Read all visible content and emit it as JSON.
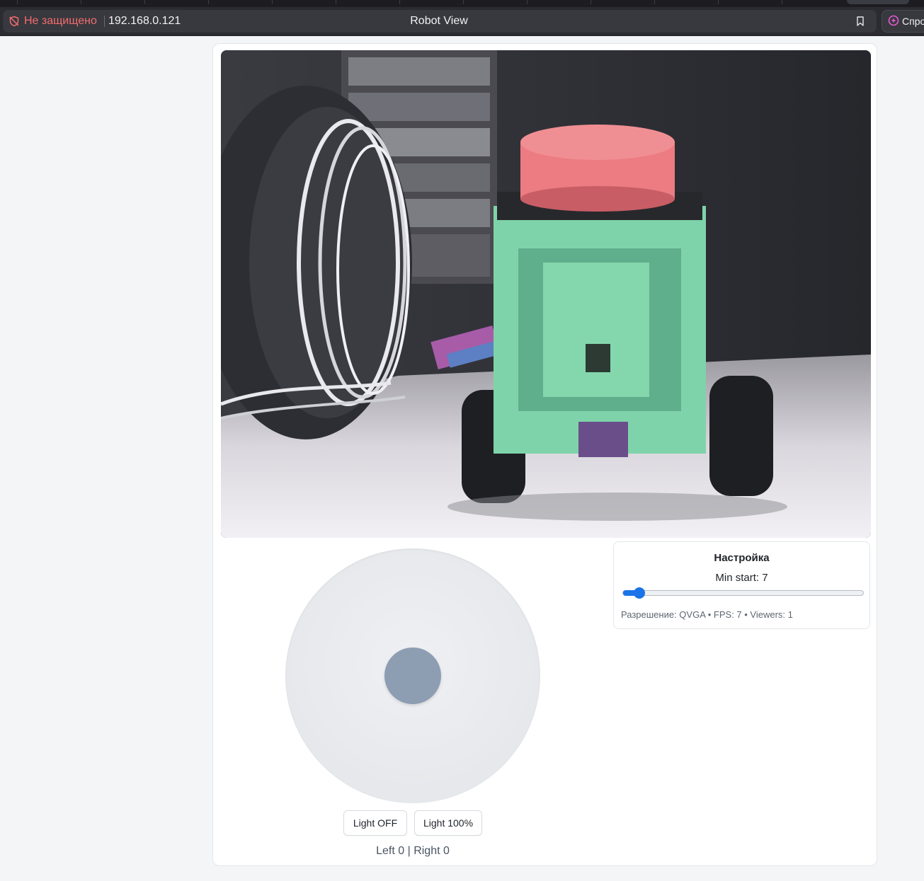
{
  "browser": {
    "security_label": "Не защищено",
    "url": "192.168.0.121",
    "page_title": "Robot View",
    "ask_label": "Спро",
    "security_color": "#f36d6d"
  },
  "video": {
    "description_icon": "camera-feed"
  },
  "joystick": {
    "x": 0,
    "y": 0
  },
  "controls": {
    "light_off_label": "Light OFF",
    "light_on_label": "Light 100%",
    "status_text": "Left 0 | Right 0"
  },
  "settings": {
    "title": "Настройка",
    "min_start_label": "Min start: 7",
    "min_start_value": 7,
    "min_start_fraction": 0.07,
    "info_text": "Разрешение: QVGA • FPS: 7 • Viewers: 1"
  },
  "colors": {
    "accent": "#1a73e8",
    "knob": "#8d9db2"
  }
}
